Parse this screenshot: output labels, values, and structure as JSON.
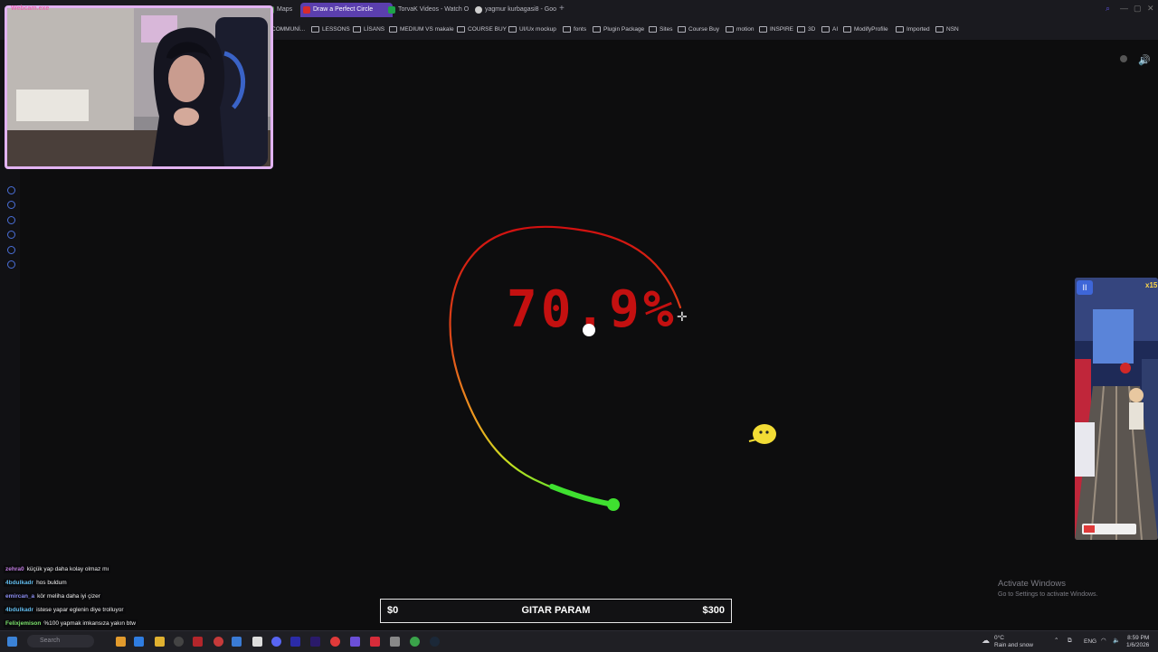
{
  "browser": {
    "tabs": [
      {
        "label": "Maps",
        "active": false,
        "color": "#3b7f3b"
      },
      {
        "label": "Draw a Perfect Circle",
        "active": true,
        "color": "#d82b2b"
      },
      {
        "label": "TorvaK Videos - Watch O",
        "active": false,
        "color": "#1fa34a"
      },
      {
        "label": "yagmur kurbagasi8 - Goo",
        "active": false,
        "color": "#cfcfcf"
      }
    ],
    "new_tab_label": "+",
    "bookmarks": [
      "COMMUNİ...",
      "LESSONS",
      "LİSANS",
      "MEDIUM VS makale",
      "COURSE BUY",
      "UI/Ux mockup",
      "fonts",
      "Plugin Package",
      "Sites",
      "Course Buy",
      "motion",
      "INSPIRE",
      "3D",
      "AI",
      "ModifyProfile",
      "Imported",
      "NSN"
    ]
  },
  "webcam": {
    "title": "Webcam.exe"
  },
  "game": {
    "score_text": "70.9%",
    "score_value": 70.9,
    "score_color": "#c41010"
  },
  "side_game": {
    "multiplier": "x15",
    "pause_icon": "pause-icon"
  },
  "windows_notice": {
    "title": "Activate Windows",
    "subtitle": "Go to Settings to activate Windows."
  },
  "goal_bar": {
    "left": "$0",
    "center": "GITAR PARAM",
    "right": "$300"
  },
  "chat": [
    {
      "user": "zehra0",
      "user_color": "#c07be0",
      "message": "küçük yap daha kolay olmaz mı"
    },
    {
      "user": "4bdulkadr",
      "user_color": "#5fb8e8",
      "message": "hos buldum"
    },
    {
      "user": "emircan_a",
      "user_color": "#8a8cf0",
      "message": "kör meliha daha iyi çizer"
    },
    {
      "user": "4bdulkadr",
      "user_color": "#5fb8e8",
      "message": "istese yapar eglenin diye trolluyor"
    },
    {
      "user": "Felixjemison",
      "user_color": "#7ae06a",
      "message": "%100 yapmak imkansıza yakın btw"
    }
  ],
  "taskbar": {
    "search_placeholder": "Search",
    "weather_temp": "0°C",
    "weather_desc": "Rain and snow",
    "language": "ENG",
    "time": "8:59 PM",
    "date": "1/6/2026"
  }
}
